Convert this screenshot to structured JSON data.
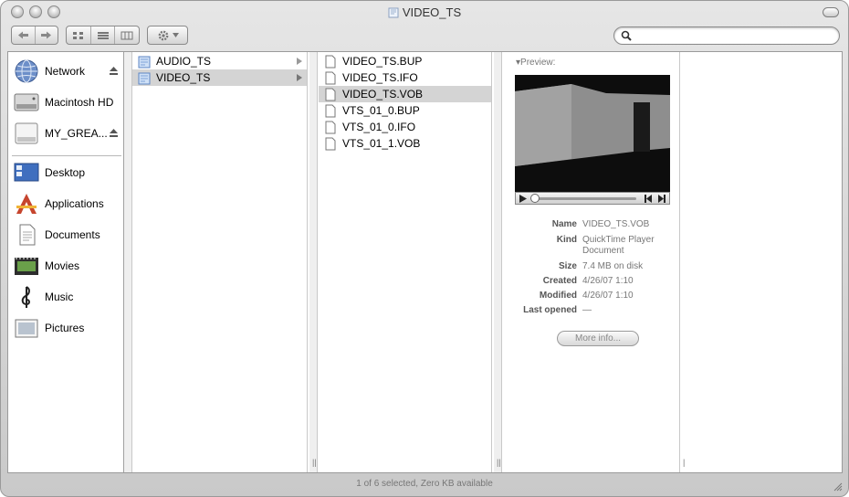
{
  "window": {
    "title": "VIDEO_TS",
    "status": "1 of 6 selected, Zero KB available"
  },
  "toolbar": {
    "back_icon": "back-arrow-icon",
    "forward_icon": "forward-arrow-icon",
    "views": [
      "icon-view-icon",
      "list-view-icon",
      "column-view-icon"
    ],
    "action_icon": "gear-icon",
    "search_placeholder": ""
  },
  "sidebar": {
    "devices": [
      {
        "label": "Network",
        "icon": "globe-icon",
        "eject": true
      },
      {
        "label": "Macintosh HD",
        "icon": "hard-drive-icon",
        "eject": false
      },
      {
        "label": "MY_GREA...",
        "icon": "disc-icon",
        "eject": true
      }
    ],
    "places": [
      {
        "label": "Desktop",
        "icon": "desktop-icon"
      },
      {
        "label": "Applications",
        "icon": "applications-icon"
      },
      {
        "label": "Documents",
        "icon": "documents-icon"
      },
      {
        "label": "Movies",
        "icon": "movies-icon"
      },
      {
        "label": "Music",
        "icon": "music-icon"
      },
      {
        "label": "Pictures",
        "icon": "pictures-icon"
      }
    ]
  },
  "columns": {
    "col1": [
      {
        "label": "AUDIO_TS",
        "selected": false
      },
      {
        "label": "VIDEO_TS",
        "selected": true
      }
    ],
    "col2": [
      {
        "label": "VIDEO_TS.BUP",
        "selected": false
      },
      {
        "label": "VIDEO_TS.IFO",
        "selected": false
      },
      {
        "label": "VIDEO_TS.VOB",
        "selected": true
      },
      {
        "label": "VTS_01_0.BUP",
        "selected": false
      },
      {
        "label": "VTS_01_0.IFO",
        "selected": false
      },
      {
        "label": "VTS_01_1.VOB",
        "selected": false
      }
    ]
  },
  "preview": {
    "header": "Preview:",
    "info": [
      {
        "key": "Name",
        "value": "VIDEO_TS.VOB"
      },
      {
        "key": "Kind",
        "value": "QuickTime Player Document"
      },
      {
        "key": "Size",
        "value": "7.4 MB on disk"
      },
      {
        "key": "Created",
        "value": "4/26/07 1:10"
      },
      {
        "key": "Modified",
        "value": "4/26/07 1:10"
      },
      {
        "key": "Last opened",
        "value": "—"
      }
    ],
    "more_info": "More info..."
  }
}
